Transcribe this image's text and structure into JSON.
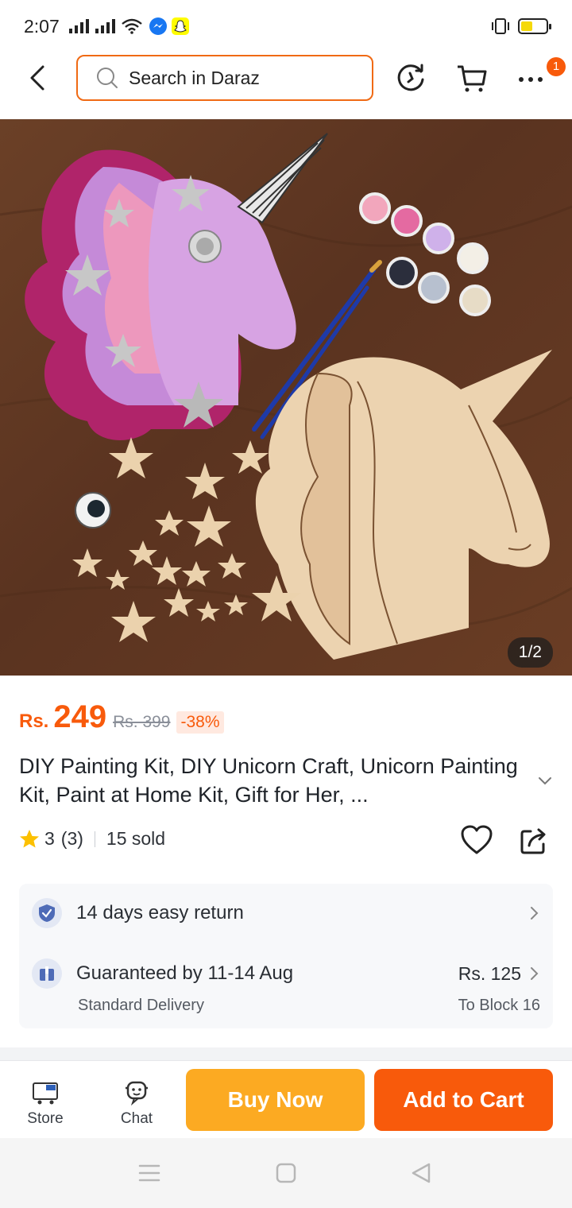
{
  "status_bar": {
    "time": "2:07"
  },
  "header": {
    "search_placeholder": "Search in Daraz",
    "notification_count": "1"
  },
  "gallery": {
    "counter": "1/2"
  },
  "product": {
    "currency": "Rs.",
    "price": "249",
    "old_price": "Rs. 399",
    "discount": "-38%",
    "title": "DIY Painting Kit, DIY Unicorn Craft, Unicorn Painting Kit, Paint at Home Kit, Gift for Her, ...",
    "rating": "3",
    "rating_count": "(3)",
    "sold": "15 sold"
  },
  "services": {
    "return_policy": "14 days easy return",
    "delivery_title": "Guaranteed by 11-14 Aug",
    "delivery_type": "Standard Delivery",
    "delivery_price": "Rs. 125",
    "delivery_location": "To Block 16"
  },
  "actions": {
    "store_label": "Store",
    "chat_label": "Chat",
    "buy_now_label": "Buy Now",
    "add_to_cart_label": "Add to Cart"
  },
  "colors": {
    "accent": "#f85a0b",
    "buy_now": "#fcaa22",
    "search_border": "#f06a14"
  }
}
